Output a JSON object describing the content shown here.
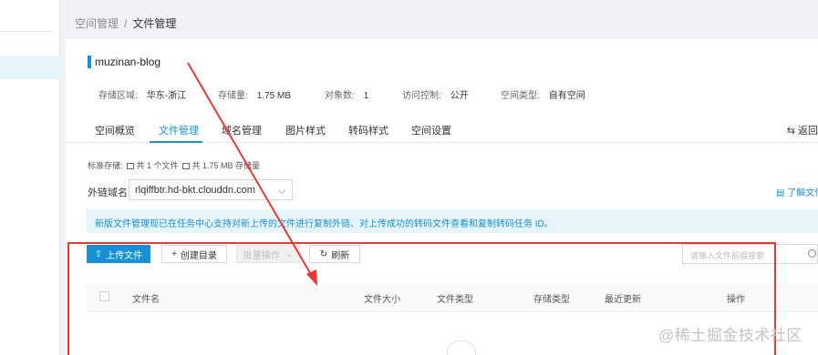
{
  "breadcrumb": {
    "root": "空间管理",
    "separator": "/",
    "current": "文件管理"
  },
  "bucket": {
    "name": "muzinan-blog",
    "meta": [
      {
        "label": "存储区域:",
        "value": "华东-浙江"
      },
      {
        "label": "存储量:",
        "value": "1.75 MB"
      },
      {
        "label": "对象数:",
        "value": "1"
      },
      {
        "label": "访问控制:",
        "value": "公开"
      },
      {
        "label": "空间类型:",
        "value": "自有空间"
      }
    ]
  },
  "tabs": [
    {
      "label": "空间概览"
    },
    {
      "label": "文件管理",
      "active": true
    },
    {
      "label": "域名管理"
    },
    {
      "label": "图片样式"
    },
    {
      "label": "转码样式"
    },
    {
      "label": "空间设置"
    }
  ],
  "back_label": "返回",
  "storage": {
    "type": "标准存储:",
    "files": "共 1 个文件",
    "size": "共 1.75 MB 存储量"
  },
  "domain": {
    "label": "外链域名:",
    "value": "rlqiffbtr.hd-bkt.clouddn.com",
    "help": "了解文件"
  },
  "notice": "新版文件管理现已在任务中心支持对新上传的文件进行复制外链、对上传成功的转码文件查看和复制转码任务 ID。",
  "toolbar": {
    "upload": "上传文件",
    "mkdir": "创建目录",
    "batch": "批量操作",
    "refresh": "刷新",
    "search_placeholder": "请输入文件前缀搜索"
  },
  "table": {
    "columns": [
      "文件名",
      "文件大小",
      "文件类型",
      "存储类型",
      "最近更新",
      "操作"
    ]
  },
  "watermark": "@稀土掘金技术社区",
  "colors": {
    "accent": "#1890d6",
    "annotation": "#e53935",
    "notice_bg": "#e6f4fb"
  }
}
